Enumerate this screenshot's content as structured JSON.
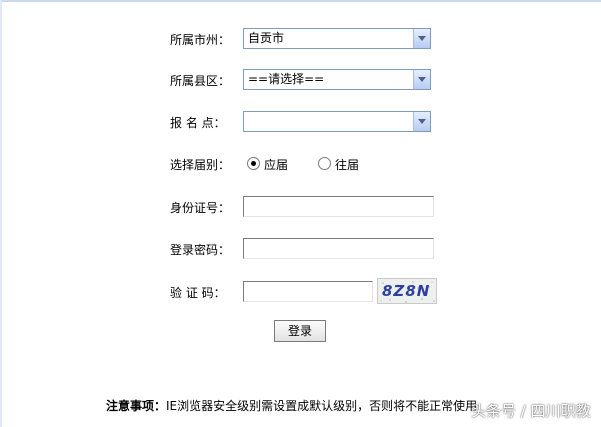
{
  "form": {
    "city": {
      "label": "所属市州：",
      "value": "自贡市"
    },
    "county": {
      "label": "所属县区：",
      "value": "==请选择=="
    },
    "site": {
      "label": "报 名 点：",
      "value": ""
    },
    "session": {
      "label": "选择届别：",
      "options": [
        {
          "label": "应届",
          "checked": true
        },
        {
          "label": "往届",
          "checked": false
        }
      ]
    },
    "id_number": {
      "label": "身份证号：",
      "value": ""
    },
    "password": {
      "label": "登录密码：",
      "value": ""
    },
    "captcha": {
      "label": "验 证 码：",
      "value": "",
      "code": "8Z8N"
    },
    "login_label": "登录"
  },
  "notice": {
    "title": "注意事项：",
    "text": "IE浏览器安全级别需设置成默认级别，否则将不能正常使用"
  },
  "watermark": "头条号 / 四川职教",
  "colors": {
    "field_border": "#7f9db9",
    "select_arrow": "#b7cbf3",
    "captcha_text": "#2f3fa0"
  }
}
